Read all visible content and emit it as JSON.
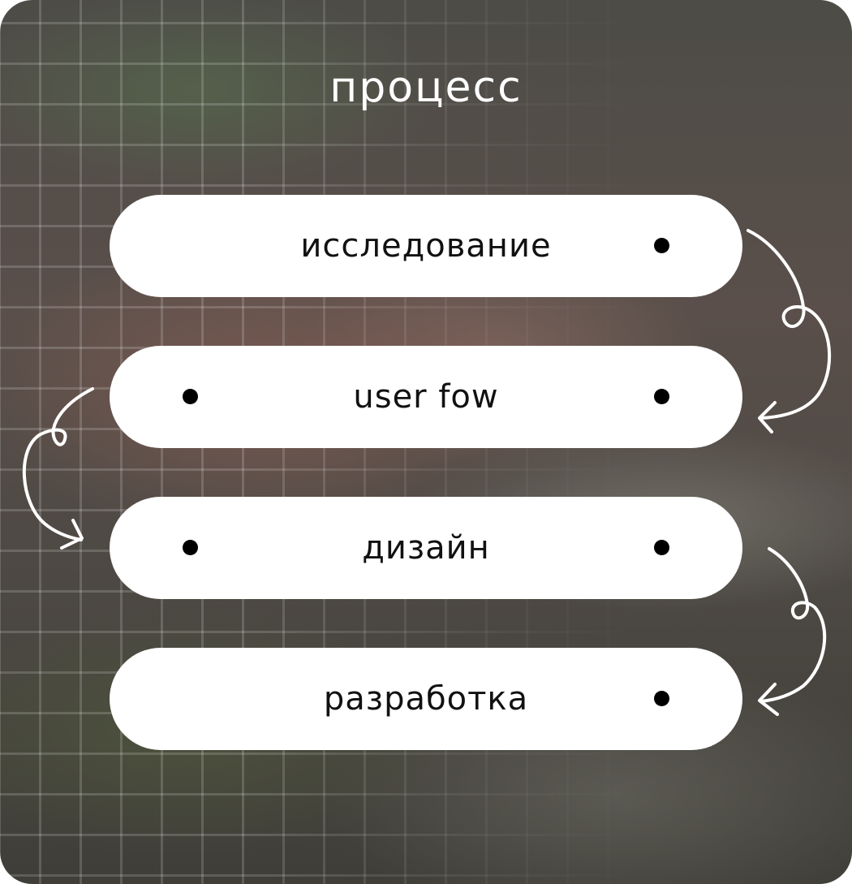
{
  "title": "процесс",
  "steps": [
    {
      "label": "исследование",
      "dot_left": false,
      "dot_right": true
    },
    {
      "label": "user fow",
      "dot_left": true,
      "dot_right": true
    },
    {
      "label": "дизайн",
      "dot_left": true,
      "dot_right": true
    },
    {
      "label": "разработка",
      "dot_left": false,
      "dot_right": true
    }
  ],
  "colors": {
    "pill": "#ffffff",
    "text": "#111111",
    "dot": "#000000",
    "arrow": "#ffffff",
    "title": "#ffffff"
  }
}
